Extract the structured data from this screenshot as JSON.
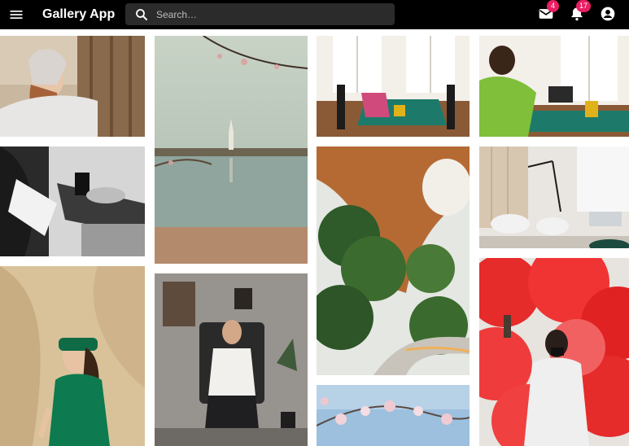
{
  "app": {
    "title": "Gallery App"
  },
  "search": {
    "placeholder": "Search…",
    "value": ""
  },
  "mail": {
    "badge": "4"
  },
  "notifications": {
    "badge": "17"
  },
  "colors": {
    "appbar": "#000000",
    "search_bg": "#2b2b2b",
    "badge": "#e91e63"
  },
  "icons": [
    "menu-icon",
    "search-icon",
    "mail-icon",
    "bell-icon",
    "account-circle-icon"
  ],
  "gallery": {
    "columns": 4,
    "photos": [
      {
        "subject": "woman leaning on wooden fence"
      },
      {
        "subject": "cherry blossom branch over reflecting pool with monument"
      },
      {
        "subject": "bright dining room with chairs and table"
      },
      {
        "subject": "woman using laptop at dining table"
      },
      {
        "subject": "black and white person reading by coffee table"
      },
      {
        "subject": "indoor garden with trees and curved walkway"
      },
      {
        "subject": "modern office lounge with chairs"
      },
      {
        "subject": "woman in green outfit against sandstone"
      },
      {
        "subject": "man in white shirt seated in armchair"
      },
      {
        "subject": "person in hoodie holding red smoke flare"
      },
      {
        "subject": "pink blossoms against blue sky"
      }
    ]
  }
}
